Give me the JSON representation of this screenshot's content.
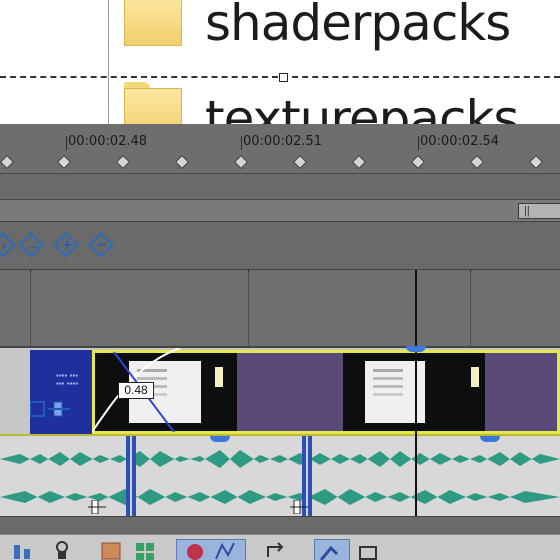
{
  "explorer": {
    "folders": [
      {
        "name": "shaderpacks"
      },
      {
        "name": "texturepacks"
      }
    ]
  },
  "timeline": {
    "ruler_labels": [
      "00:00:02.48",
      "00:00:02.51",
      "00:00:02.54"
    ],
    "fade_label": "0.48",
    "scroll_grip": "||"
  },
  "colors": {
    "clip_border": "#e7e74a",
    "clip_fill": "#5a4a7a",
    "blue_clip": "#1f2f9b",
    "waveform": "#2f9a84",
    "icon_blue": "#2a6cc0"
  },
  "icons": {
    "toolbar": [
      "prev-marker-icon",
      "go-to-marker-icon",
      "zoom-in-icon",
      "zoom-out-icon"
    ],
    "bottom_toolbar": [
      "mixer-icon",
      "lock-icon",
      "snap-icon",
      "grid-icon",
      "record-icon",
      "envelope-icon",
      "loop-icon",
      "edit-tool-icon",
      "select-icon"
    ]
  }
}
